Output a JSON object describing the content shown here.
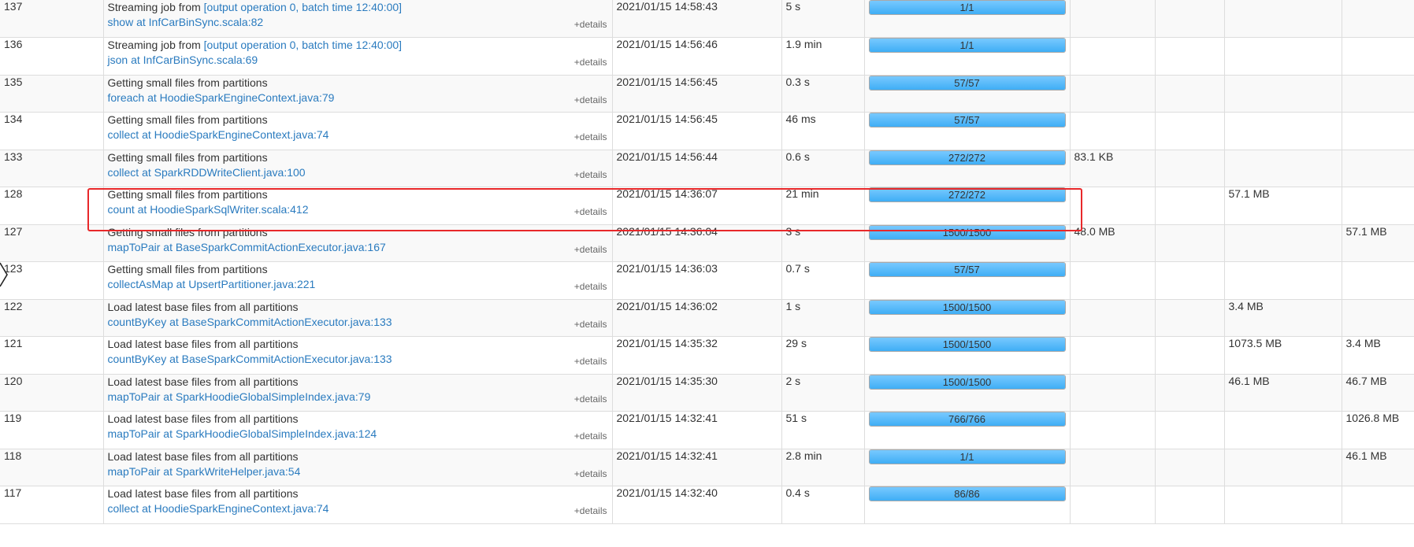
{
  "details_label": "+details",
  "colors": {
    "link": "#2a7bbf",
    "progress": "#56b8f7",
    "highlight": "#e8282a"
  },
  "rows": [
    {
      "id": "137",
      "desc": "Streaming job from ",
      "desc_link": "[output operation 0, batch time 12:40:00]",
      "call": "show at InfCarBinSync.scala:82",
      "submitted": "2021/01/15 14:58:43",
      "duration": "5 s",
      "tasks": "1/1",
      "progress": 1.0,
      "c7": "",
      "c8": "",
      "c9": "",
      "c10": ""
    },
    {
      "id": "136",
      "desc": "Streaming job from ",
      "desc_link": "[output operation 0, batch time 12:40:00]",
      "call": "json at InfCarBinSync.scala:69",
      "submitted": "2021/01/15 14:56:46",
      "duration": "1.9 min",
      "tasks": "1/1",
      "progress": 1.0,
      "c7": "",
      "c8": "",
      "c9": "",
      "c10": ""
    },
    {
      "id": "135",
      "desc": "Getting small files from partitions",
      "desc_link": "",
      "call": "foreach at HoodieSparkEngineContext.java:79",
      "submitted": "2021/01/15 14:56:45",
      "duration": "0.3 s",
      "tasks": "57/57",
      "progress": 1.0,
      "c7": "",
      "c8": "",
      "c9": "",
      "c10": ""
    },
    {
      "id": "134",
      "desc": "Getting small files from partitions",
      "desc_link": "",
      "call": "collect at HoodieSparkEngineContext.java:74",
      "submitted": "2021/01/15 14:56:45",
      "duration": "46 ms",
      "tasks": "57/57",
      "progress": 1.0,
      "c7": "",
      "c8": "",
      "c9": "",
      "c10": ""
    },
    {
      "id": "133",
      "desc": "Getting small files from partitions",
      "desc_link": "",
      "call": "collect at SparkRDDWriteClient.java:100",
      "submitted": "2021/01/15 14:56:44",
      "duration": "0.6 s",
      "tasks": "272/272",
      "progress": 1.0,
      "c7": "83.1 KB",
      "c8": "",
      "c9": "",
      "c10": ""
    },
    {
      "id": "128",
      "desc": "Getting small files from partitions",
      "desc_link": "",
      "call": "count at HoodieSparkSqlWriter.scala:412",
      "submitted": "2021/01/15 14:36:07",
      "duration": "21 min",
      "tasks": "272/272",
      "progress": 1.0,
      "c7": "",
      "c8": "",
      "c9": "57.1 MB",
      "c10": ""
    },
    {
      "id": "127",
      "desc": "Getting small files from partitions",
      "desc_link": "",
      "call": "mapToPair at BaseSparkCommitActionExecutor.java:167",
      "submitted": "2021/01/15 14:36:04",
      "duration": "3 s",
      "tasks": "1500/1500",
      "progress": 1.0,
      "c7": "48.0 MB",
      "c8": "",
      "c9": "",
      "c10": "57.1 MB"
    },
    {
      "id": "123",
      "desc": "Getting small files from partitions",
      "desc_link": "",
      "call": "collectAsMap at UpsertPartitioner.java:221",
      "submitted": "2021/01/15 14:36:03",
      "duration": "0.7 s",
      "tasks": "57/57",
      "progress": 1.0,
      "c7": "",
      "c8": "",
      "c9": "",
      "c10": ""
    },
    {
      "id": "122",
      "desc": "Load latest base files from all partitions",
      "desc_link": "",
      "call": "countByKey at BaseSparkCommitActionExecutor.java:133",
      "submitted": "2021/01/15 14:36:02",
      "duration": "1 s",
      "tasks": "1500/1500",
      "progress": 1.0,
      "c7": "",
      "c8": "",
      "c9": "3.4 MB",
      "c10": ""
    },
    {
      "id": "121",
      "desc": "Load latest base files from all partitions",
      "desc_link": "",
      "call": "countByKey at BaseSparkCommitActionExecutor.java:133",
      "submitted": "2021/01/15 14:35:32",
      "duration": "29 s",
      "tasks": "1500/1500",
      "progress": 1.0,
      "c7": "",
      "c8": "",
      "c9": "1073.5 MB",
      "c10": "3.4 MB"
    },
    {
      "id": "120",
      "desc": "Load latest base files from all partitions",
      "desc_link": "",
      "call": "mapToPair at SparkHoodieGlobalSimpleIndex.java:79",
      "submitted": "2021/01/15 14:35:30",
      "duration": "2 s",
      "tasks": "1500/1500",
      "progress": 1.0,
      "c7": "",
      "c8": "",
      "c9": "46.1 MB",
      "c10": "46.7 MB"
    },
    {
      "id": "119",
      "desc": "Load latest base files from all partitions",
      "desc_link": "",
      "call": "mapToPair at SparkHoodieGlobalSimpleIndex.java:124",
      "submitted": "2021/01/15 14:32:41",
      "duration": "51 s",
      "tasks": "766/766",
      "progress": 1.0,
      "c7": "",
      "c8": "",
      "c9": "",
      "c10": "1026.8 MB"
    },
    {
      "id": "118",
      "desc": "Load latest base files from all partitions",
      "desc_link": "",
      "call": "mapToPair at SparkWriteHelper.java:54",
      "submitted": "2021/01/15 14:32:41",
      "duration": "2.8 min",
      "tasks": "1/1",
      "progress": 1.0,
      "c7": "",
      "c8": "",
      "c9": "",
      "c10": "46.1 MB"
    },
    {
      "id": "117",
      "desc": "Load latest base files from all partitions",
      "desc_link": "",
      "call": "collect at HoodieSparkEngineContext.java:74",
      "submitted": "2021/01/15 14:32:40",
      "duration": "0.4 s",
      "tasks": "86/86",
      "progress": 1.0,
      "c7": "",
      "c8": "",
      "c9": "",
      "c10": ""
    }
  ]
}
